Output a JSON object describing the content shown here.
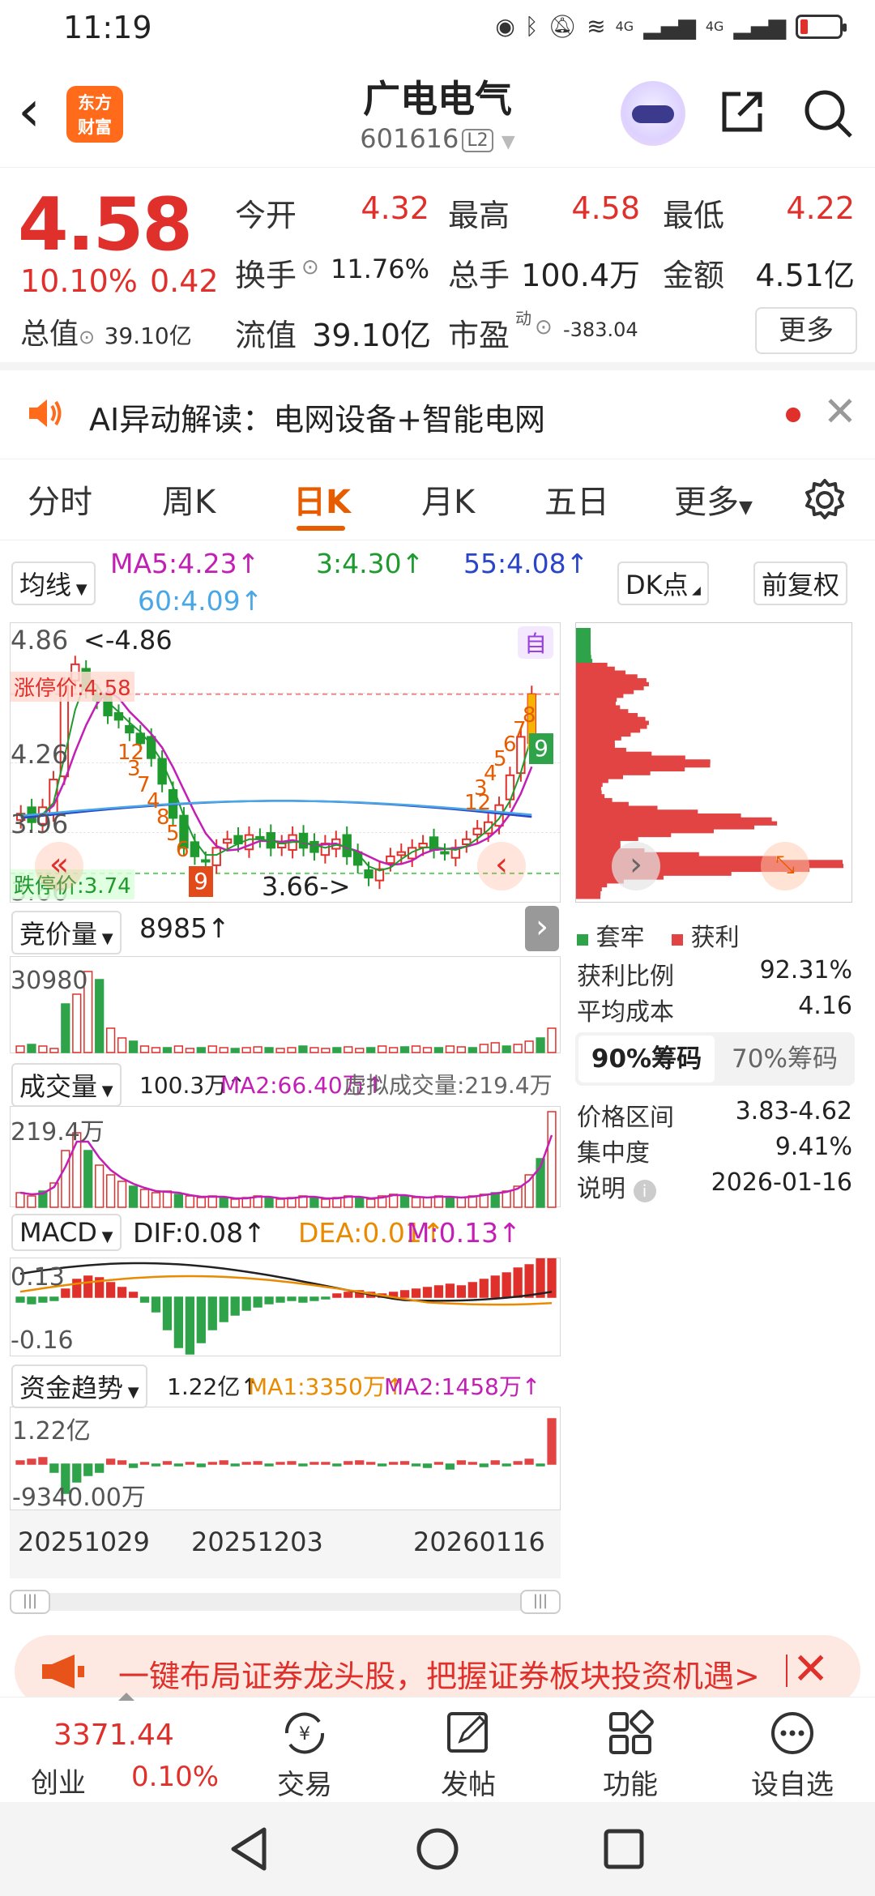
{
  "status": {
    "time": "11:19",
    "net1": "4G",
    "net2": "4G"
  },
  "header": {
    "logo_line1": "东方",
    "logo_line2": "财富",
    "title": "广电电气",
    "code": "601616",
    "level": "L2"
  },
  "quote": {
    "price": "4.58",
    "change_pct": "10.10%",
    "change": "0.42",
    "open_label": "今开",
    "open": "4.32",
    "high_label": "最高",
    "high": "4.58",
    "low_label": "最低",
    "low": "4.22",
    "turnover_label": "换手",
    "turnover": "11.76%",
    "volume_label": "总手",
    "volume": "100.4万",
    "amount_label": "金额",
    "amount": "4.51亿",
    "mcap_label": "总值",
    "mcap": "39.10亿",
    "float_label": "流值",
    "float": "39.10亿",
    "pe_label": "市盈",
    "pe_sup": "动",
    "pe": "-383.04",
    "more": "更多"
  },
  "ai_banner": {
    "text": "AI异动解读：电网设备+智能电网"
  },
  "tabs": [
    "分时",
    "周K",
    "日K",
    "月K",
    "五日",
    "更多"
  ],
  "active_tab": "日K",
  "ma_row": {
    "selector": "均线",
    "ma5": "MA5:4.23↑",
    "ma3": "3:4.30↑",
    "ma55": "55:4.08↑",
    "ma60": "60:4.09↑",
    "dk": "DK点",
    "adjust": "前复权"
  },
  "kline": {
    "y_top": "4.86",
    "y_mid": "4.26",
    "y_low": "3.96",
    "y_bottom": "3.66",
    "max_note": "<-4.86",
    "min_note": "3.66->",
    "limit_up": "涨停价:4.58",
    "limit_down": "跌停价:3.74",
    "auto_tag": "自",
    "nine_up": "9",
    "nine_down": "9",
    "seq_marks_left": [
      "12",
      "3",
      "7",
      "4",
      "8",
      "5",
      "6"
    ],
    "seq_marks_right": [
      "12",
      "3",
      "4",
      "5",
      "6",
      "7",
      "8"
    ],
    "candles_close": [
      4.02,
      3.98,
      4.05,
      4.18,
      4.62,
      4.72,
      4.6,
      4.55,
      4.48,
      4.46,
      4.4,
      4.35,
      4.28,
      4.16,
      4.0,
      3.86,
      3.82,
      3.8,
      3.86,
      3.9,
      3.88,
      3.92,
      3.9,
      3.86,
      3.88,
      3.92,
      3.86,
      3.84,
      3.88,
      3.9,
      3.82,
      3.78,
      3.72,
      3.76,
      3.82,
      3.84,
      3.86,
      3.88,
      3.85,
      3.84,
      3.86,
      3.9,
      3.95,
      3.98,
      4.06,
      4.2,
      4.38,
      4.58
    ]
  },
  "chip": {
    "legend_locked": "套牢",
    "legend_profit": "获利",
    "profit_ratio_label": "获利比例",
    "profit_ratio": "92.31%",
    "avg_cost_label": "平均成本",
    "avg_cost": "4.16",
    "seg_on": "90%筹码",
    "seg_off": "70%筹码",
    "range_label": "价格区间",
    "range": "3.83-4.62",
    "conc_label": "集中度",
    "conc": "9.41%",
    "note_label": "说明",
    "note": "2026-01-16"
  },
  "auction": {
    "selector": "竞价量",
    "value": "8985↑",
    "y_top": "30980"
  },
  "volume": {
    "selector": "成交量",
    "v": "100.3万↑",
    "ma2": "MA2:66.40万↑",
    "virtual": "虚拟成交量:219.4万",
    "y_top": "219.4万"
  },
  "macd": {
    "selector": "MACD",
    "dif": "DIF:0.08↑",
    "dea": "DEA:0.01↑",
    "m": "M:0.13↑",
    "y_top": "0.13",
    "y_bottom": "-0.16"
  },
  "fund": {
    "selector": "资金趋势",
    "v": "1.22亿↑",
    "ma1": "MA1:3350万↑",
    "ma2": "MA2:1458万↑",
    "y_top": "1.22亿",
    "y_bottom": "-9340.00万"
  },
  "dates": [
    "20251029",
    "20251203",
    "20260116"
  ],
  "ad": {
    "text": "一键布局证券龙头股，把握证券板块投资机遇>"
  },
  "bottom": {
    "index_value": "3371.44",
    "index_name": "创业",
    "index_change": "0.10%",
    "items": [
      "交易",
      "发帖",
      "功能",
      "设自选"
    ]
  },
  "colors": {
    "up": "#e0302b",
    "down": "#1f9a2e",
    "accent": "#e85c00"
  }
}
